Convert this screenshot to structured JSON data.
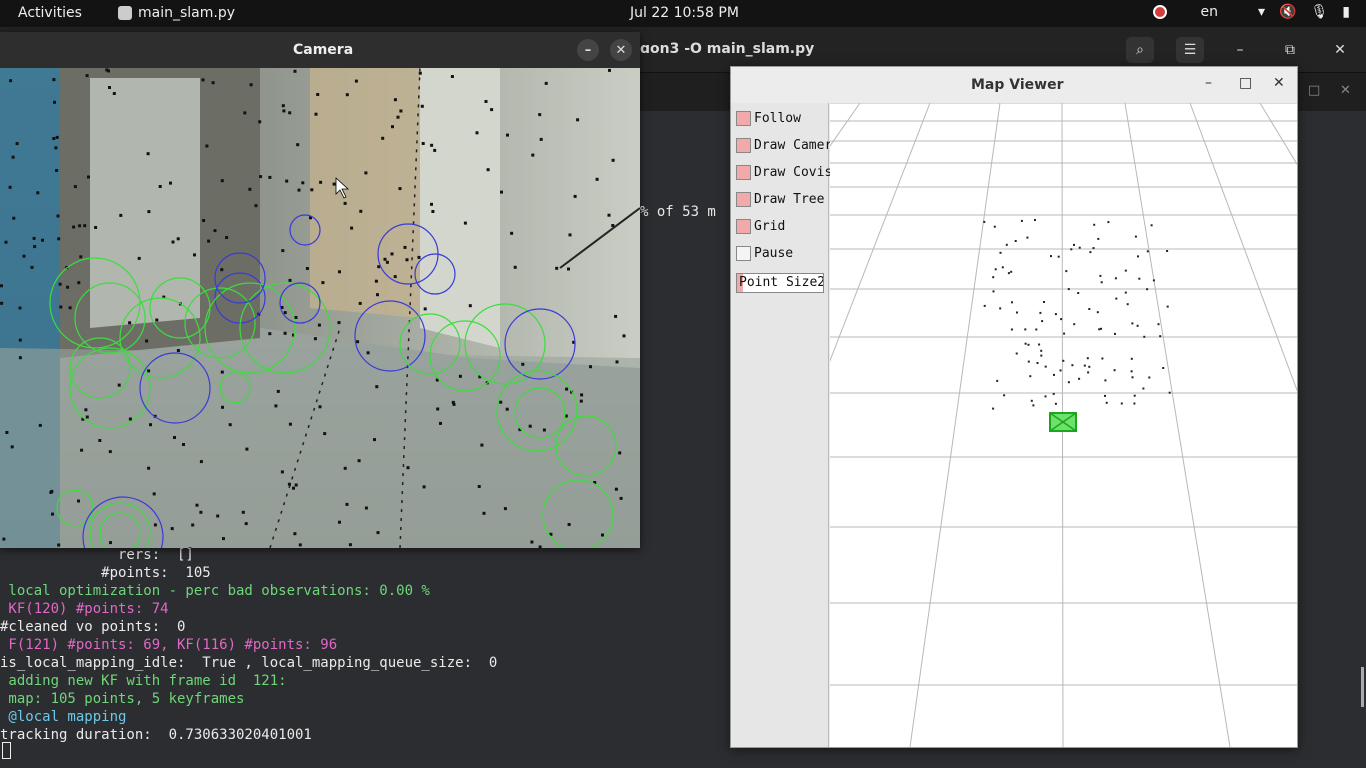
{
  "topbar": {
    "activities": "Activities",
    "app_name": "main_slam.py",
    "clock": "Jul 22  10:58 PM",
    "lang": "en"
  },
  "terminal": {
    "title": "ɑon3 -O main_slam.py",
    "partial": "% of  53 m",
    "lines": [
      {
        "text": "              rers:  []",
        "color": "white"
      },
      {
        "text": "            #points:  105",
        "color": "white"
      },
      {
        "text": " local optimization - perc bad observations: 0.00 %",
        "color": "green"
      },
      {
        "text": " KF(120) #points: 74",
        "color": "pink"
      },
      {
        "text": "#cleaned vo points:  0",
        "color": "white"
      },
      {
        "text": " F(121) #points: 69, KF(116) #points: 96",
        "color": "pink"
      },
      {
        "text": "is_local_mapping_idle:  True , local_mapping_queue_size:  0",
        "color": "white"
      },
      {
        "text": " adding new KF with frame id  121:",
        "color": "green"
      },
      {
        "text": " map: 105 points, 5 keyframes",
        "color": "green"
      },
      {
        "text": " @local mapping",
        "color": "cyan"
      },
      {
        "text": "tracking duration:  0.730633020401001",
        "color": "white"
      }
    ]
  },
  "camera_window": {
    "title": "Camera",
    "minimize": "–",
    "close": "✕"
  },
  "map_viewer": {
    "title": "Map Viewer",
    "controls": [
      "–",
      "□",
      "✕"
    ],
    "options": [
      {
        "label": "Follow",
        "checked": true
      },
      {
        "label": "Draw Cameras",
        "checked": true
      },
      {
        "label": "Draw Covisibility",
        "checked": true
      },
      {
        "label": "Draw Tree",
        "checked": true
      },
      {
        "label": "Grid",
        "checked": true
      },
      {
        "label": "Pause",
        "checked": false
      }
    ],
    "point_size_label": "Point Size",
    "point_size_value": "2"
  },
  "colors": {
    "feature_green": "#3ddc3d",
    "feature_blue": "#3a3ad8",
    "checkbox_on": "#f2a9a9"
  }
}
